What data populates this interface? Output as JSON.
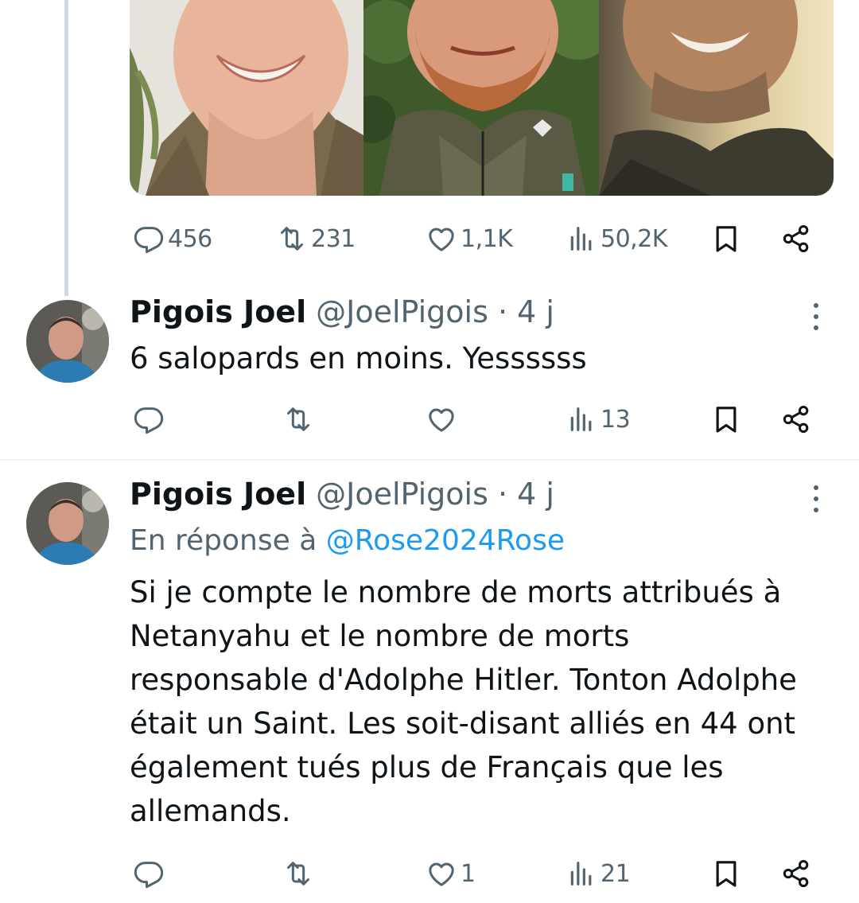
{
  "top_tweet": {
    "stats": {
      "replies": "456",
      "retweets": "231",
      "likes": "1,1K",
      "views": "50,2K"
    }
  },
  "replies": [
    {
      "name": "Pigois Joel",
      "handle": "@JoelPigois · 4 j",
      "text": "6 salopards en moins. Yessssss",
      "stats": {
        "replies": "",
        "retweets": "",
        "likes": "",
        "views": "13"
      }
    },
    {
      "name": "Pigois Joel",
      "handle": "@JoelPigois · 4 j",
      "reply_prefix": "En réponse à ",
      "reply_mention": "@Rose2024Rose",
      "text": "Si je compte le nombre de morts attribués à\nNetanyahu  et le nombre de morts\nresponsable d'Adolphe Hitler. Tonton Adolphe\nétait un Saint. Les soit-disant alliés en 44 ont\négalement tués  plus de Français  que les\nallemands.",
      "stats": {
        "replies": "",
        "retweets": "",
        "likes": "1",
        "views": "21"
      }
    }
  ],
  "icons": [
    "reply-icon",
    "retweet-icon",
    "like-icon",
    "views-icon",
    "bookmark-icon",
    "share-icon",
    "more-icon"
  ],
  "colors": {
    "accent": "#1d9bf0",
    "text": "#0f1419",
    "secondary": "#536471",
    "divider": "#eff3f4"
  }
}
